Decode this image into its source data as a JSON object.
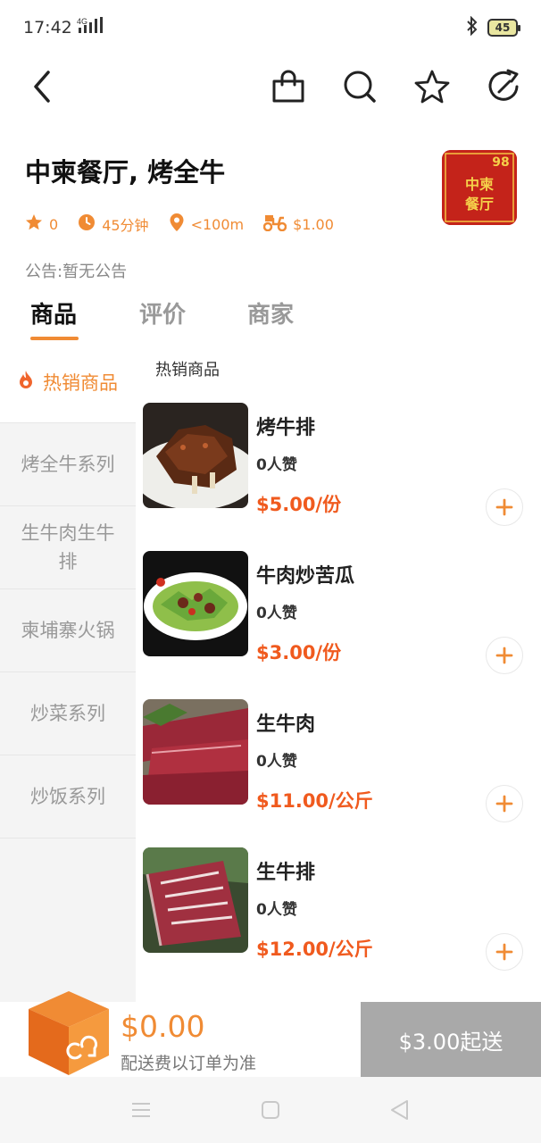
{
  "status": {
    "time": "17:42",
    "network": "4G",
    "battery": "45"
  },
  "nav": {
    "back_icon": "back-arrow-icon",
    "icons": [
      "shopping-bag-icon",
      "search-icon",
      "star-icon",
      "share-icon"
    ]
  },
  "shop": {
    "name": "中柬餐厅, 烤全牛",
    "rating": "0",
    "time": "45分钟",
    "distance": "<100m",
    "delivery_fee": "$1.00",
    "notice": "公告:暂无公告",
    "logo_text": [
      "中柬",
      "餐厅",
      "98"
    ]
  },
  "tabs": [
    {
      "label": "商品",
      "active": true
    },
    {
      "label": "评价",
      "active": false
    },
    {
      "label": "商家",
      "active": false
    }
  ],
  "categories": [
    "热销商品",
    "烤全牛系列",
    "生牛肉生牛排",
    "柬埔寨火锅",
    "炒菜系列",
    "炒饭系列"
  ],
  "section_title": "热销商品",
  "products": [
    {
      "name": "烤牛排",
      "likes": "0人赞",
      "price": "$5.00/份"
    },
    {
      "name": "牛肉炒苦瓜",
      "likes": "0人赞",
      "price": "$3.00/份"
    },
    {
      "name": "生牛肉",
      "likes": "0人赞",
      "price": "$11.00/公斤"
    },
    {
      "name": "生牛排",
      "likes": "0人赞",
      "price": "$12.00/公斤"
    }
  ],
  "cart": {
    "total": "$0.00",
    "note": "配送费以订单为准",
    "checkout_label": "$3.00起送"
  },
  "colors": {
    "accent": "#f08b34",
    "price": "#f05a1e",
    "checkout_disabled": "#a9a9a9"
  }
}
